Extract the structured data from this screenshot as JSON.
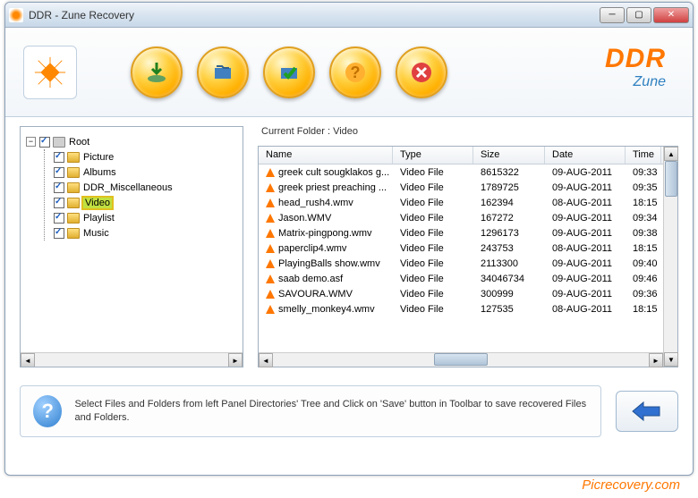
{
  "window": {
    "title": "DDR - Zune Recovery"
  },
  "brand": {
    "name": "DDR",
    "product": "Zune"
  },
  "tree": {
    "root": "Root",
    "items": [
      {
        "label": "Picture",
        "checked": true
      },
      {
        "label": "Albums",
        "checked": true
      },
      {
        "label": "DDR_Miscellaneous",
        "checked": true
      },
      {
        "label": "Video",
        "checked": true,
        "selected": true
      },
      {
        "label": "Playlist",
        "checked": true
      },
      {
        "label": "Music",
        "checked": true
      }
    ]
  },
  "currentFolder": {
    "label": "Current Folder   :   Video"
  },
  "columns": {
    "name": "Name",
    "type": "Type",
    "size": "Size",
    "date": "Date",
    "time": "Time"
  },
  "rows": [
    {
      "name": "greek cult sougklakos g...",
      "type": "Video File",
      "size": "8615322",
      "date": "09-AUG-2011",
      "time": "09:33"
    },
    {
      "name": "greek priest preaching ...",
      "type": "Video File",
      "size": "1789725",
      "date": "09-AUG-2011",
      "time": "09:35"
    },
    {
      "name": "head_rush4.wmv",
      "type": "Video File",
      "size": "162394",
      "date": "08-AUG-2011",
      "time": "18:15"
    },
    {
      "name": "Jason.WMV",
      "type": "Video File",
      "size": "167272",
      "date": "09-AUG-2011",
      "time": "09:34"
    },
    {
      "name": "Matrix-pingpong.wmv",
      "type": "Video File",
      "size": "1296173",
      "date": "09-AUG-2011",
      "time": "09:38"
    },
    {
      "name": "paperclip4.wmv",
      "type": "Video File",
      "size": "243753",
      "date": "08-AUG-2011",
      "time": "18:15"
    },
    {
      "name": "PlayingBalls show.wmv",
      "type": "Video File",
      "size": "2113300",
      "date": "09-AUG-2011",
      "time": "09:40"
    },
    {
      "name": "saab demo.asf",
      "type": "Video File",
      "size": "34046734",
      "date": "09-AUG-2011",
      "time": "09:46"
    },
    {
      "name": "SAVOURA.WMV",
      "type": "Video File",
      "size": "300999",
      "date": "09-AUG-2011",
      "time": "09:36"
    },
    {
      "name": "smelly_monkey4.wmv",
      "type": "Video File",
      "size": "127535",
      "date": "08-AUG-2011",
      "time": "18:15"
    }
  ],
  "hint": {
    "text": "Select Files and Folders from left Panel Directories' Tree and Click on 'Save' button in Toolbar to save recovered Files and Folders."
  },
  "watermark": "Picrecovery.com"
}
